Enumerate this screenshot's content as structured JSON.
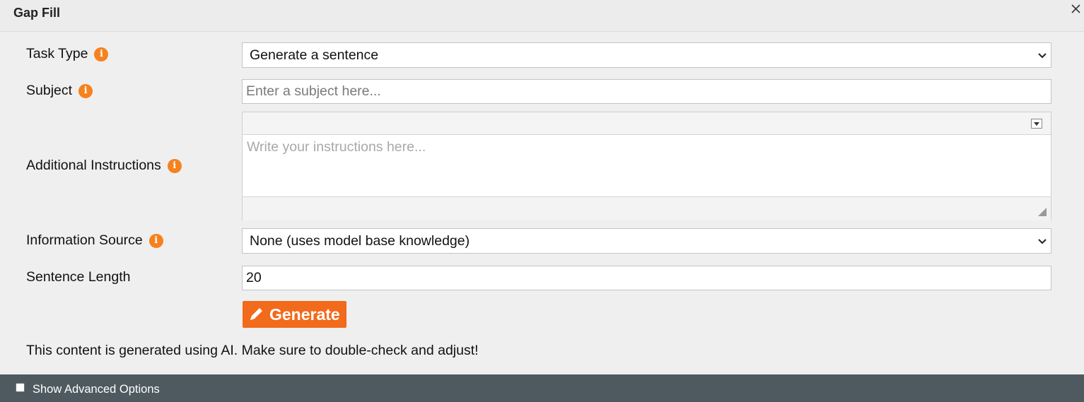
{
  "dialog": {
    "title": "Gap Fill",
    "close_icon": "close-icon"
  },
  "form": {
    "task_type": {
      "label": "Task Type",
      "value": "Generate a sentence",
      "info_icon": "info-icon"
    },
    "subject": {
      "label": "Subject",
      "placeholder": "Enter a subject here...",
      "value": "",
      "info_icon": "info-icon"
    },
    "instructions": {
      "label": "Additional Instructions",
      "placeholder": "Write your instructions here...",
      "value": "",
      "info_icon": "info-icon"
    },
    "information_source": {
      "label": "Information Source",
      "value": "None (uses model base knowledge)",
      "info_icon": "info-icon"
    },
    "sentence_length": {
      "label": "Sentence Length",
      "value": "20"
    }
  },
  "generate_button": {
    "label": "Generate",
    "icon": "pencil-icon"
  },
  "notice": "This content is generated using AI. Make sure to double-check and adjust!",
  "footer": {
    "advanced_options_label": "Show Advanced Options",
    "advanced_options_checked": false
  },
  "colors": {
    "accent": "#f26a1b",
    "info_badge": "#f5821f",
    "footer_bg": "#4e5a60",
    "panel_bg": "#efefef"
  }
}
